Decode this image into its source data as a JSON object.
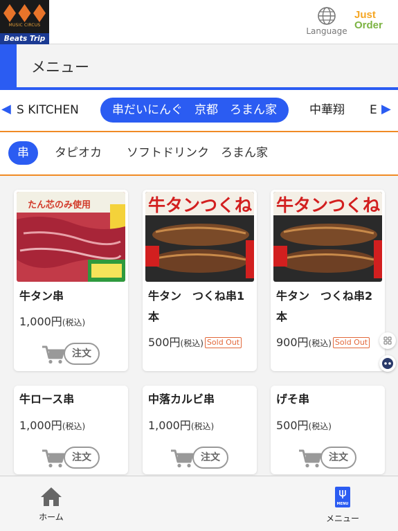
{
  "header": {
    "logo_small_text": "MUSIC CIRCUS",
    "logo_brand": "Beats Trip",
    "language_label": "Language",
    "app_logo": {
      "just": "Just",
      "order": "Order"
    }
  },
  "title": "メニュー",
  "shop_tabs": {
    "items": [
      {
        "label": "S KITCHEN",
        "active": false
      },
      {
        "label": "串だいにんぐ　京都　ろまん家",
        "active": true
      },
      {
        "label": "中華翔",
        "active": false
      },
      {
        "label": "E",
        "active": false
      }
    ]
  },
  "category_tabs": {
    "items": [
      {
        "label": "串",
        "active": true
      },
      {
        "label": "タピオカ",
        "active": false
      },
      {
        "label": "ソフトドリンク　ろまん家",
        "active": false
      }
    ]
  },
  "products": [
    {
      "name": "牛タン串",
      "price": "1,000円",
      "tax": "(税込)",
      "sold_out": "",
      "order_label": "注文",
      "image_caption": "たん芯のみ使用"
    },
    {
      "name": "牛タン　つくね串1本",
      "price": "500円",
      "tax": "(税込)",
      "sold_out": "Sold Out",
      "image_caption": "牛タンつくね"
    },
    {
      "name": "牛タン　つくね串2本",
      "price": "900円",
      "tax": "(税込)",
      "sold_out": "Sold Out",
      "image_caption": "牛タンつくね"
    },
    {
      "name": "牛ロース串",
      "price": "1,000円",
      "tax": "(税込)",
      "sold_out": "",
      "order_label": "注文"
    },
    {
      "name": "中落カルビ串",
      "price": "1,000円",
      "tax": "(税込)",
      "sold_out": "",
      "order_label": "注文"
    },
    {
      "name": "げそ串",
      "price": "500円",
      "tax": "(税込)",
      "sold_out": "",
      "order_label": "注文"
    }
  ],
  "bottom_nav": {
    "home": "ホーム",
    "menu": "メニュー",
    "menu_badge": "MENU"
  },
  "colors": {
    "primary": "#2b5cf2",
    "accent": "#f08a24",
    "sold_out": "#e2683a"
  }
}
